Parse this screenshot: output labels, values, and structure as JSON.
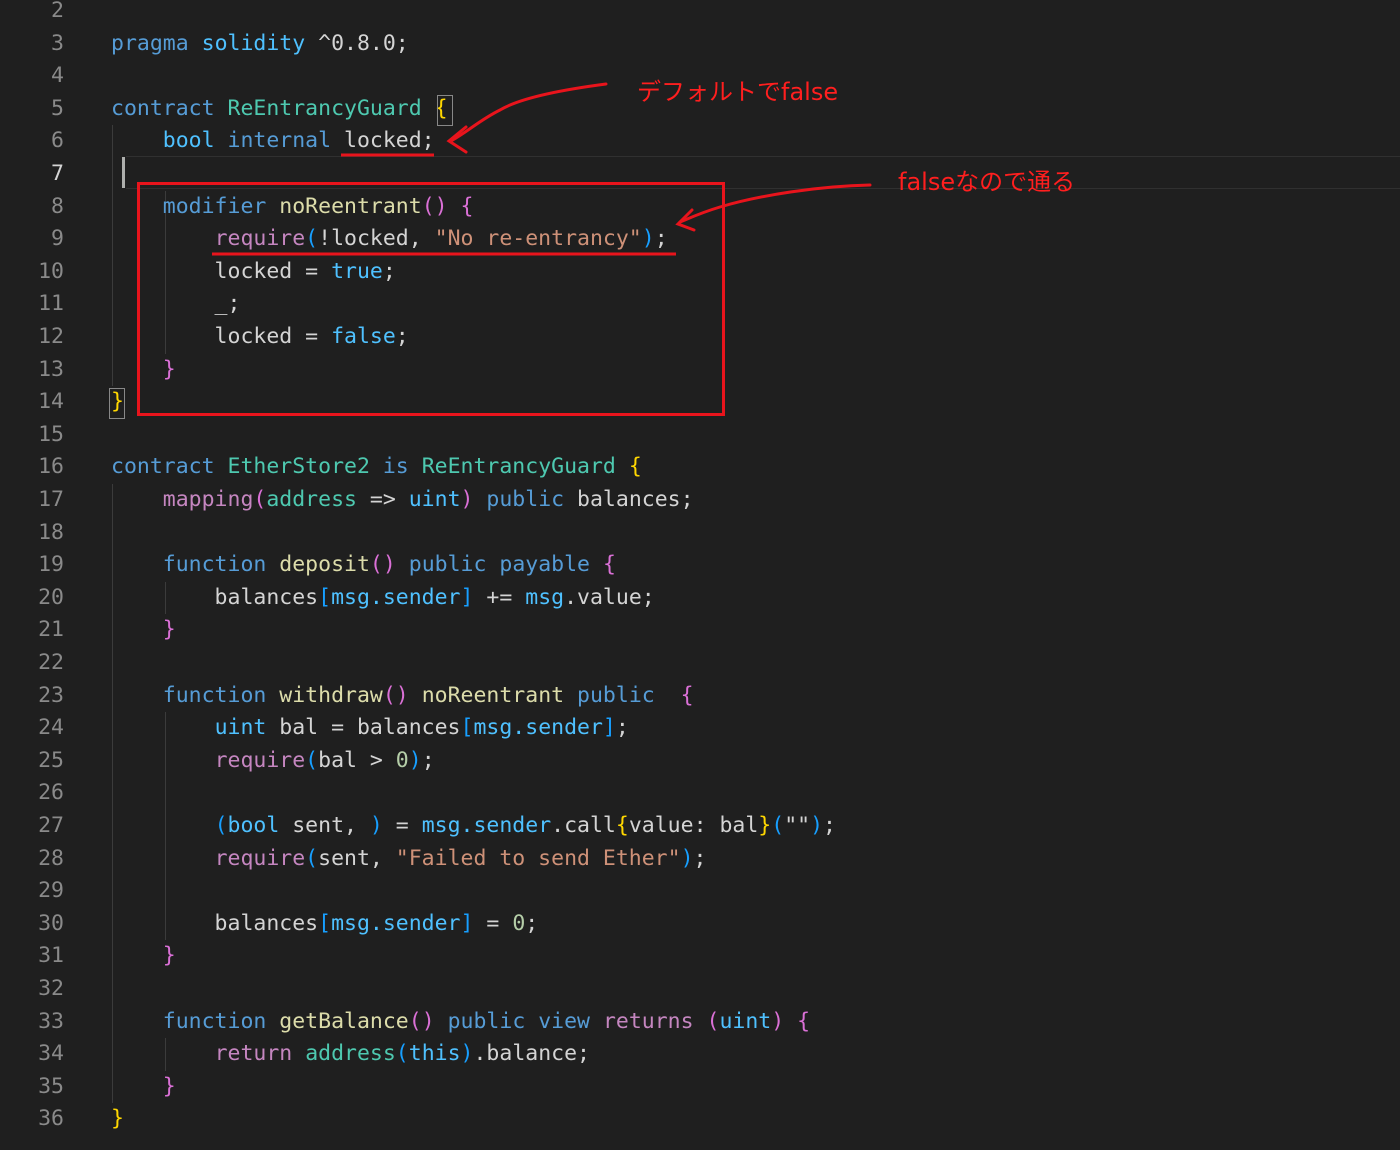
{
  "editor": {
    "language": "solidity",
    "active_line": "7",
    "lines": [
      {
        "n": "2",
        "tokens": []
      },
      {
        "n": "3",
        "tokens": [
          [
            "pragma",
            "kw"
          ],
          [
            " ",
            ""
          ],
          [
            "solidity",
            "ty"
          ],
          [
            " ^0.8.0;",
            ""
          ]
        ]
      },
      {
        "n": "4",
        "tokens": []
      },
      {
        "n": "5",
        "tokens": [
          [
            "contract",
            "kw"
          ],
          [
            " ",
            ""
          ],
          [
            "ReEntrancyGuard",
            "cls"
          ],
          [
            " ",
            ""
          ],
          [
            "{",
            "br1"
          ]
        ]
      },
      {
        "n": "6",
        "tokens": [
          [
            "    ",
            ""
          ],
          [
            "bool",
            "ty"
          ],
          [
            " ",
            ""
          ],
          [
            "internal",
            "kw"
          ],
          [
            " locked;",
            ""
          ]
        ]
      },
      {
        "n": "7",
        "tokens": []
      },
      {
        "n": "8",
        "tokens": [
          [
            "    ",
            ""
          ],
          [
            "modifier",
            "kw"
          ],
          [
            " ",
            ""
          ],
          [
            "noReentrant",
            "fn"
          ],
          [
            "()",
            "br2"
          ],
          [
            " ",
            ""
          ],
          [
            "{",
            "br2"
          ]
        ]
      },
      {
        "n": "9",
        "tokens": [
          [
            "        ",
            ""
          ],
          [
            "require",
            "ctl"
          ],
          [
            "(",
            "br3"
          ],
          [
            "!locked, ",
            ""
          ],
          [
            "\"No re-entrancy\"",
            "str"
          ],
          [
            ")",
            "br3"
          ],
          [
            ";",
            ""
          ]
        ]
      },
      {
        "n": "10",
        "tokens": [
          [
            "        locked = ",
            ""
          ],
          [
            "true",
            "ty"
          ],
          [
            ";",
            ""
          ]
        ]
      },
      {
        "n": "11",
        "tokens": [
          [
            "        _;",
            ""
          ]
        ]
      },
      {
        "n": "12",
        "tokens": [
          [
            "        locked = ",
            ""
          ],
          [
            "false",
            "ty"
          ],
          [
            ";",
            ""
          ]
        ]
      },
      {
        "n": "13",
        "tokens": [
          [
            "    ",
            ""
          ],
          [
            "}",
            "br2"
          ]
        ]
      },
      {
        "n": "14",
        "tokens": [
          [
            "}",
            "br1"
          ]
        ]
      },
      {
        "n": "15",
        "tokens": []
      },
      {
        "n": "16",
        "tokens": [
          [
            "contract",
            "kw"
          ],
          [
            " ",
            ""
          ],
          [
            "EtherStore2",
            "cls"
          ],
          [
            " ",
            ""
          ],
          [
            "is",
            "kw"
          ],
          [
            " ",
            ""
          ],
          [
            "ReEntrancyGuard",
            "cls"
          ],
          [
            " ",
            ""
          ],
          [
            "{",
            "br1"
          ]
        ]
      },
      {
        "n": "17",
        "tokens": [
          [
            "    ",
            ""
          ],
          [
            "mapping",
            "ctl"
          ],
          [
            "(",
            "br2"
          ],
          [
            "address",
            "cls"
          ],
          [
            " => ",
            ""
          ],
          [
            "uint",
            "ty"
          ],
          [
            ")",
            "br2"
          ],
          [
            " ",
            ""
          ],
          [
            "public",
            "kw"
          ],
          [
            " balances;",
            ""
          ]
        ]
      },
      {
        "n": "18",
        "tokens": []
      },
      {
        "n": "19",
        "tokens": [
          [
            "    ",
            ""
          ],
          [
            "function",
            "kw"
          ],
          [
            " ",
            ""
          ],
          [
            "deposit",
            "fn"
          ],
          [
            "()",
            "br2"
          ],
          [
            " ",
            ""
          ],
          [
            "public",
            "kw"
          ],
          [
            " ",
            ""
          ],
          [
            "payable",
            "kw"
          ],
          [
            " ",
            ""
          ],
          [
            "{",
            "br2"
          ]
        ]
      },
      {
        "n": "20",
        "tokens": [
          [
            "        balances",
            ""
          ],
          [
            "[",
            "br3"
          ],
          [
            "msg.sender",
            "ty"
          ],
          [
            "]",
            "br3"
          ],
          [
            " += ",
            ""
          ],
          [
            "msg",
            "ty"
          ],
          [
            ".value;",
            ""
          ]
        ]
      },
      {
        "n": "21",
        "tokens": [
          [
            "    ",
            ""
          ],
          [
            "}",
            "br2"
          ]
        ]
      },
      {
        "n": "22",
        "tokens": []
      },
      {
        "n": "23",
        "tokens": [
          [
            "    ",
            ""
          ],
          [
            "function",
            "kw"
          ],
          [
            " ",
            ""
          ],
          [
            "withdraw",
            "fn"
          ],
          [
            "()",
            "br2"
          ],
          [
            " ",
            ""
          ],
          [
            "noReentrant",
            "fn"
          ],
          [
            " ",
            ""
          ],
          [
            "public",
            "kw"
          ],
          [
            "  ",
            ""
          ],
          [
            "{",
            "br2"
          ]
        ]
      },
      {
        "n": "24",
        "tokens": [
          [
            "        ",
            ""
          ],
          [
            "uint",
            "ty"
          ],
          [
            " bal = balances",
            ""
          ],
          [
            "[",
            "br3"
          ],
          [
            "msg.sender",
            "ty"
          ],
          [
            "]",
            "br3"
          ],
          [
            ";",
            ""
          ]
        ]
      },
      {
        "n": "25",
        "tokens": [
          [
            "        ",
            ""
          ],
          [
            "require",
            "ctl"
          ],
          [
            "(",
            "br3"
          ],
          [
            "bal > ",
            ""
          ],
          [
            "0",
            "num"
          ],
          [
            ")",
            "br3"
          ],
          [
            ";",
            ""
          ]
        ]
      },
      {
        "n": "26",
        "tokens": []
      },
      {
        "n": "27",
        "tokens": [
          [
            "        ",
            ""
          ],
          [
            "(",
            "br3"
          ],
          [
            "bool",
            "ty"
          ],
          [
            " sent, ",
            ""
          ],
          [
            ")",
            "br3"
          ],
          [
            " = ",
            ""
          ],
          [
            "msg.sender",
            "ty"
          ],
          [
            ".call",
            ""
          ],
          [
            "{",
            "br1"
          ],
          [
            "value: bal",
            ""
          ],
          [
            "}",
            "br1"
          ],
          [
            "(",
            "br3"
          ],
          [
            "\"\"",
            ""
          ],
          [
            ")",
            "br3"
          ],
          [
            ";",
            ""
          ]
        ]
      },
      {
        "n": "28",
        "tokens": [
          [
            "        ",
            ""
          ],
          [
            "require",
            "ctl"
          ],
          [
            "(",
            "br3"
          ],
          [
            "sent, ",
            ""
          ],
          [
            "\"Failed to send Ether\"",
            "str"
          ],
          [
            ")",
            "br3"
          ],
          [
            ";",
            ""
          ]
        ]
      },
      {
        "n": "29",
        "tokens": []
      },
      {
        "n": "30",
        "tokens": [
          [
            "        balances",
            ""
          ],
          [
            "[",
            "br3"
          ],
          [
            "msg.sender",
            "ty"
          ],
          [
            "]",
            "br3"
          ],
          [
            " = ",
            ""
          ],
          [
            "0",
            "num"
          ],
          [
            ";",
            ""
          ]
        ]
      },
      {
        "n": "31",
        "tokens": [
          [
            "    ",
            ""
          ],
          [
            "}",
            "br2"
          ]
        ]
      },
      {
        "n": "32",
        "tokens": []
      },
      {
        "n": "33",
        "tokens": [
          [
            "    ",
            ""
          ],
          [
            "function",
            "kw"
          ],
          [
            " ",
            ""
          ],
          [
            "getBalance",
            "fn"
          ],
          [
            "()",
            "br2"
          ],
          [
            " ",
            ""
          ],
          [
            "public",
            "kw"
          ],
          [
            " ",
            ""
          ],
          [
            "view",
            "kw"
          ],
          [
            " ",
            ""
          ],
          [
            "returns",
            "ctl"
          ],
          [
            " ",
            ""
          ],
          [
            "(",
            "br2"
          ],
          [
            "uint",
            "ty"
          ],
          [
            ")",
            "br2"
          ],
          [
            " ",
            ""
          ],
          [
            "{",
            "br2"
          ]
        ]
      },
      {
        "n": "34",
        "tokens": [
          [
            "        ",
            ""
          ],
          [
            "return",
            "ctl"
          ],
          [
            " ",
            ""
          ],
          [
            "address",
            "cls"
          ],
          [
            "(",
            "br3"
          ],
          [
            "this",
            "ty"
          ],
          [
            ")",
            "br3"
          ],
          [
            ".balance;",
            ""
          ]
        ]
      },
      {
        "n": "35",
        "tokens": [
          [
            "    ",
            ""
          ],
          [
            "}",
            "br2"
          ]
        ]
      },
      {
        "n": "36",
        "tokens": [
          [
            "}",
            "br1"
          ]
        ]
      }
    ]
  },
  "colors": {
    "kw": "#569cd6",
    "ty": "#4fc1ff",
    "cls": "#4ec9b0",
    "fn": "#dcdcaa",
    "ctl": "#c586c0",
    "str": "#ce9178",
    "num": "#b5cea8",
    "br1": "#ffd700",
    "br2": "#da70d6",
    "br3": "#179fff",
    "annotation": "#ff1f1f"
  },
  "annotations": {
    "note_default_false": "デフォルトでfalse",
    "note_false_passes": "falseなので通る"
  }
}
